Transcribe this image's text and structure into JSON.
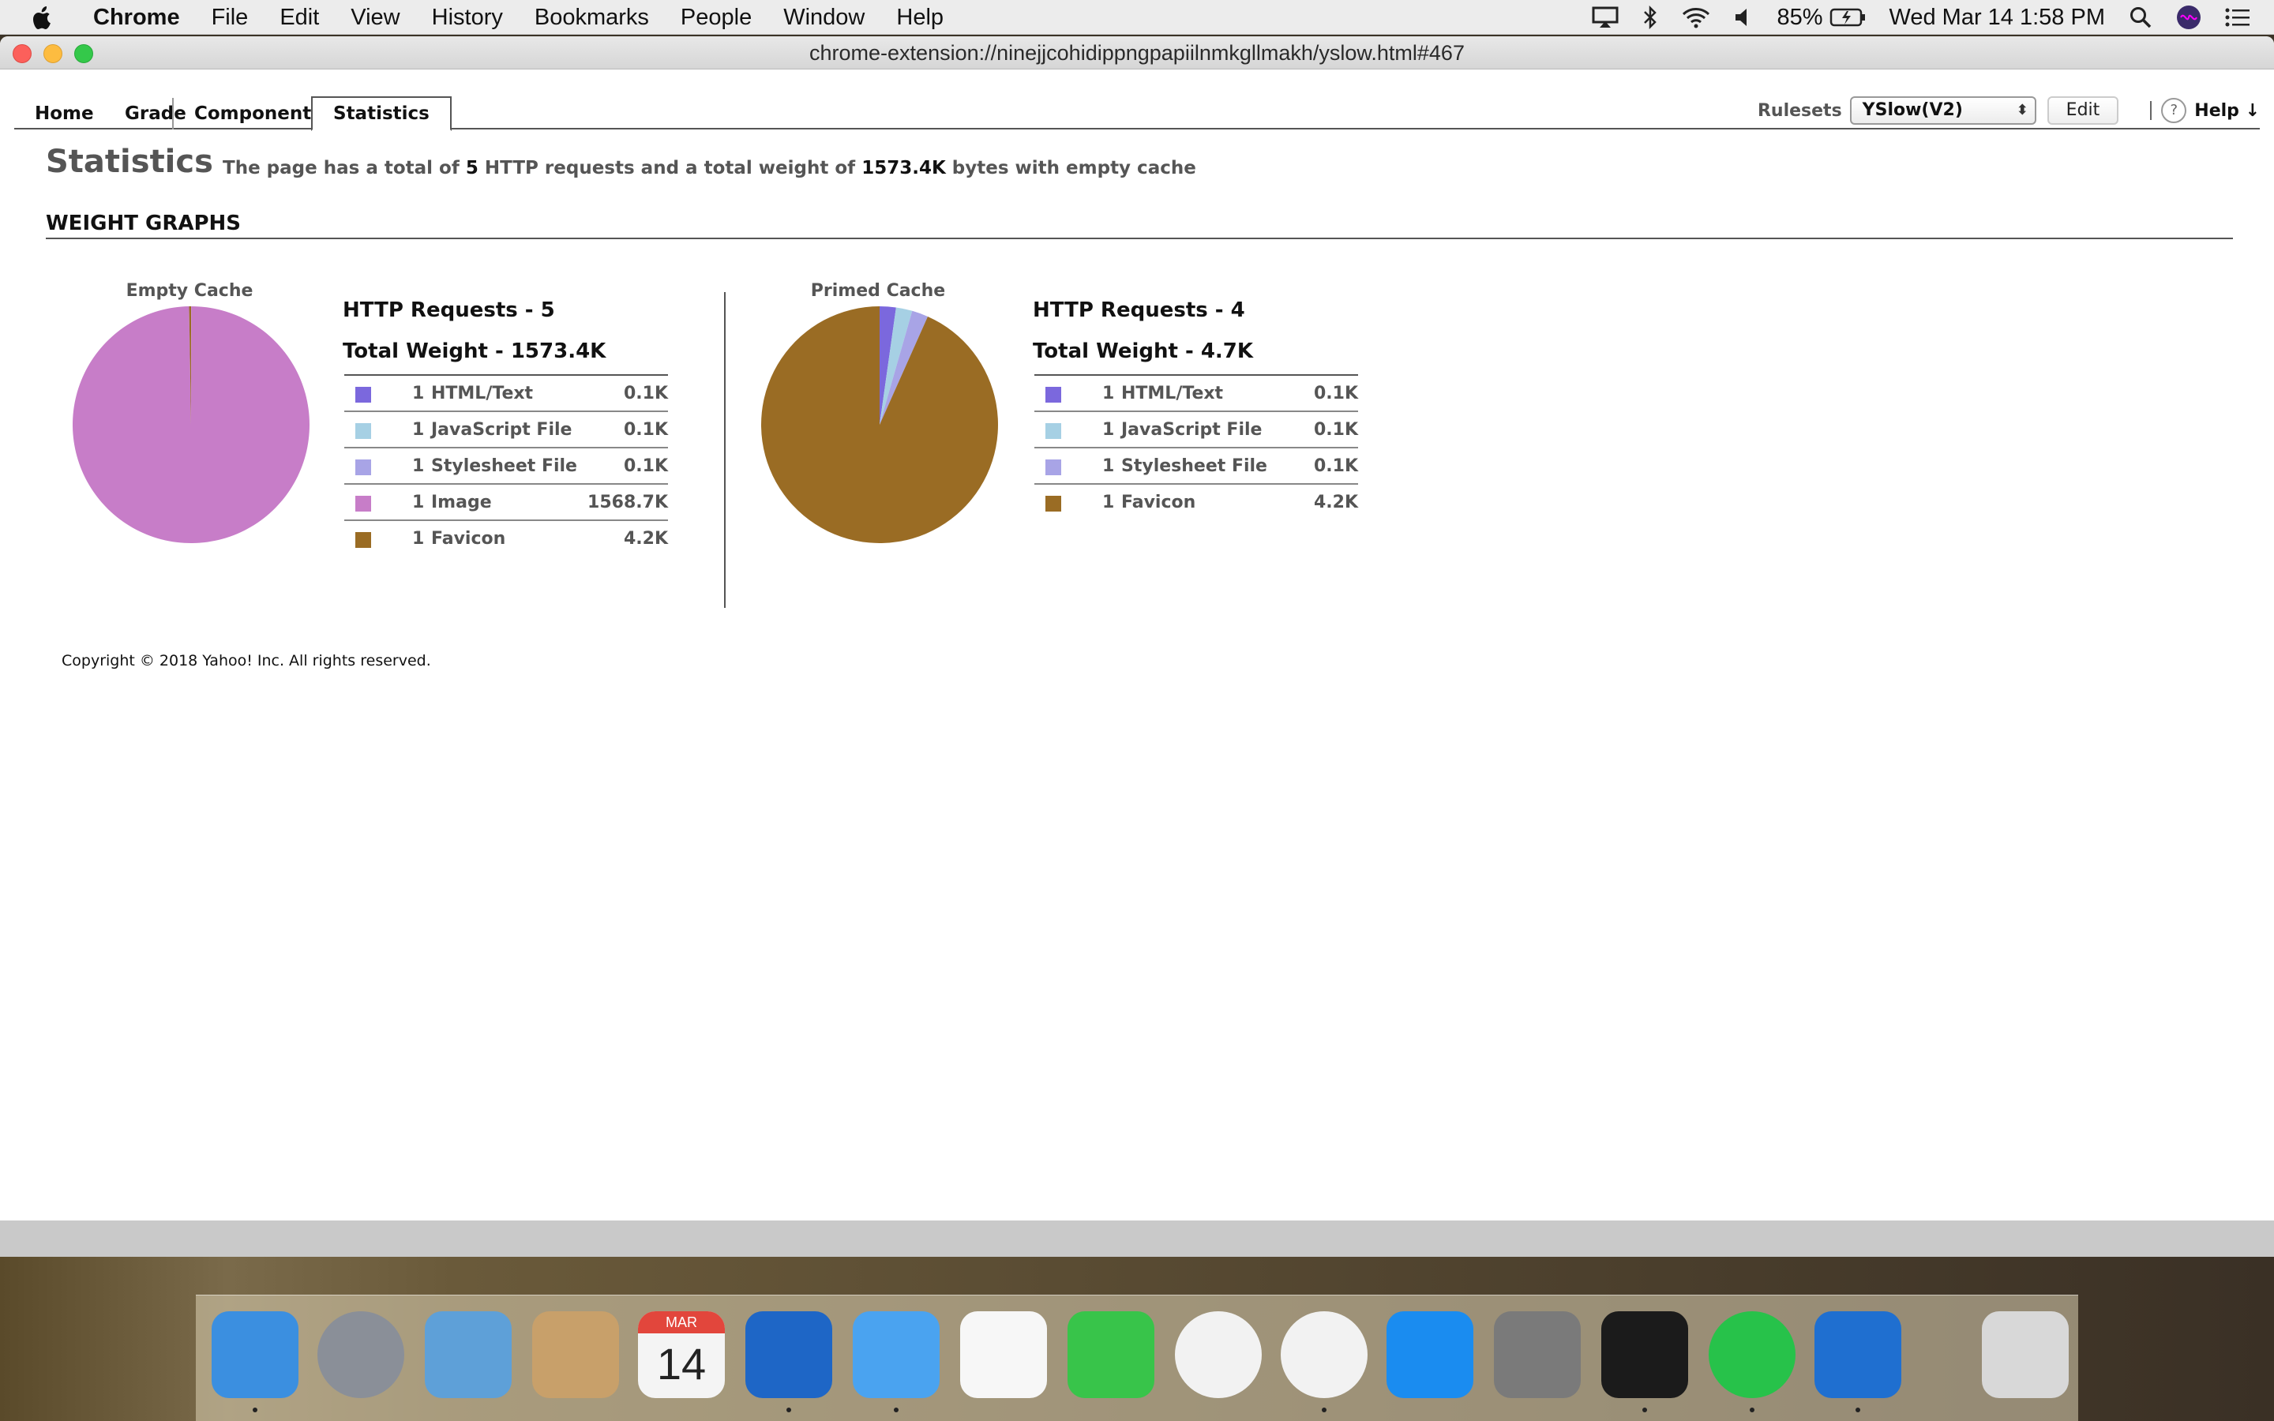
{
  "menubar": {
    "app": "Chrome",
    "items": [
      "File",
      "Edit",
      "View",
      "History",
      "Bookmarks",
      "People",
      "Window",
      "Help"
    ],
    "battery": "85%",
    "clock": "Wed Mar 14  1:58 PM"
  },
  "window": {
    "url": "chrome-extension://ninejjcohidippngpapiilnmkgllmakh/yslow.html#467"
  },
  "tabs": [
    "Home",
    "Grade",
    "Components",
    "Statistics"
  ],
  "rulesets": {
    "label": "Rulesets",
    "selected": "YSlow(V2)",
    "edit_label": "Edit",
    "help_label": "Help ↓"
  },
  "page": {
    "title": "Statistics",
    "summary_prefix": "The page has a total of",
    "summary_requests": "5",
    "summary_mid": "HTTP requests and a total weight of",
    "summary_weight": "1573.4K",
    "summary_suffix": "bytes with empty cache",
    "section_title": "WEIGHT GRAPHS",
    "copyright": "Copyright © 2018 Yahoo! Inc. All rights reserved."
  },
  "empty_cache": {
    "label": "Empty Cache",
    "requests_line": "HTTP Requests - 5",
    "weight_line": "Total Weight - 1573.4K",
    "rows": [
      {
        "count": "1",
        "type": "HTML/Text",
        "size": "0.1K",
        "color": "#7b68dd"
      },
      {
        "count": "1",
        "type": "JavaScript File",
        "size": "0.1K",
        "color": "#a6d0e4"
      },
      {
        "count": "1",
        "type": "Stylesheet File",
        "size": "0.1K",
        "color": "#a8a4e6"
      },
      {
        "count": "1",
        "type": "Image",
        "size": "1568.7K",
        "color": "#c77dc8"
      },
      {
        "count": "1",
        "type": "Favicon",
        "size": "4.2K",
        "color": "#9a6c24"
      }
    ],
    "weights": [
      0.1,
      0.1,
      0.1,
      1568.7,
      4.2
    ]
  },
  "primed_cache": {
    "label": "Primed Cache",
    "requests_line": "HTTP Requests - 4",
    "weight_line": "Total Weight - 4.7K",
    "rows": [
      {
        "count": "1",
        "type": "HTML/Text",
        "size": "0.1K",
        "color": "#7b68dd"
      },
      {
        "count": "1",
        "type": "JavaScript File",
        "size": "0.1K",
        "color": "#a6d0e4"
      },
      {
        "count": "1",
        "type": "Stylesheet File",
        "size": "0.1K",
        "color": "#a8a4e6"
      },
      {
        "count": "1",
        "type": "Favicon",
        "size": "4.2K",
        "color": "#9a6c24"
      }
    ],
    "weights": [
      0.1,
      0.1,
      0.1,
      4.2
    ]
  },
  "dock": {
    "apps": [
      "finder-icon",
      "launchpad-icon",
      "mail-icon",
      "contacts-icon",
      "calendar-icon",
      "outlook-icon",
      "messages-icon",
      "photos-icon",
      "facetime-icon",
      "itunes-icon",
      "chrome-icon",
      "app-store-icon",
      "system-preferences-icon",
      "terminal-icon",
      "whatsapp-icon",
      "webstorm-icon",
      "trash-icon"
    ],
    "calendar_month": "MAR",
    "calendar_day": "14"
  }
}
